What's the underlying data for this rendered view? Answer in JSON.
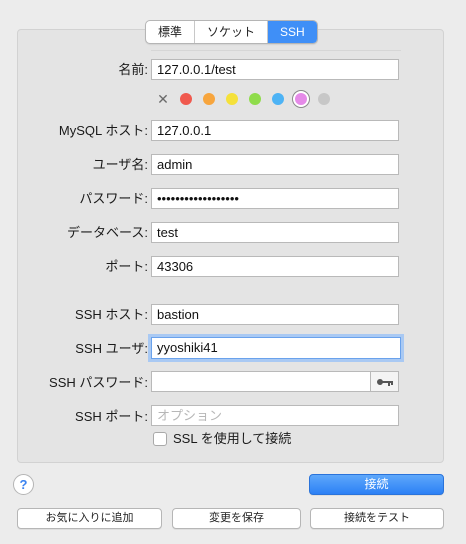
{
  "tabs": [
    {
      "label": "標準",
      "active": false
    },
    {
      "label": "ソケット",
      "active": false
    },
    {
      "label": "SSH",
      "active": true
    }
  ],
  "form": {
    "name_label": "名前:",
    "name_value": "127.0.0.1/test",
    "mysql_host_label": "MySQL ホスト:",
    "mysql_host_value": "127.0.0.1",
    "user_label": "ユーザ名:",
    "user_value": "admin",
    "password_label": "パスワード:",
    "password_value": "••••••••••••••••••",
    "database_label": "データベース:",
    "database_value": "test",
    "port_label": "ポート:",
    "port_value": "43306",
    "ssh_host_label": "SSH ホスト:",
    "ssh_host_value": "bastion",
    "ssh_user_label": "SSH ユーザ:",
    "ssh_user_value": "yyoshiki41",
    "ssh_password_label": "SSH パスワード:",
    "ssh_password_value": "",
    "ssh_port_label": "SSH ポート:",
    "ssh_port_placeholder": "オプション",
    "ssl_label": "SSL を使用して接続",
    "ssl_checked": false
  },
  "colors": {
    "clear_glyph": "✕",
    "swatches": [
      "#f0594e",
      "#f7a53d",
      "#f5e13a",
      "#8fdc4b",
      "#4db3f5",
      "#e58ae8",
      "#c7c7c7"
    ],
    "selected_index": 5
  },
  "buttons": {
    "help": "?",
    "connect": "接続",
    "add_favorite": "お気に入りに追加",
    "save_changes": "変更を保存",
    "test_connection": "接続をテスト"
  }
}
